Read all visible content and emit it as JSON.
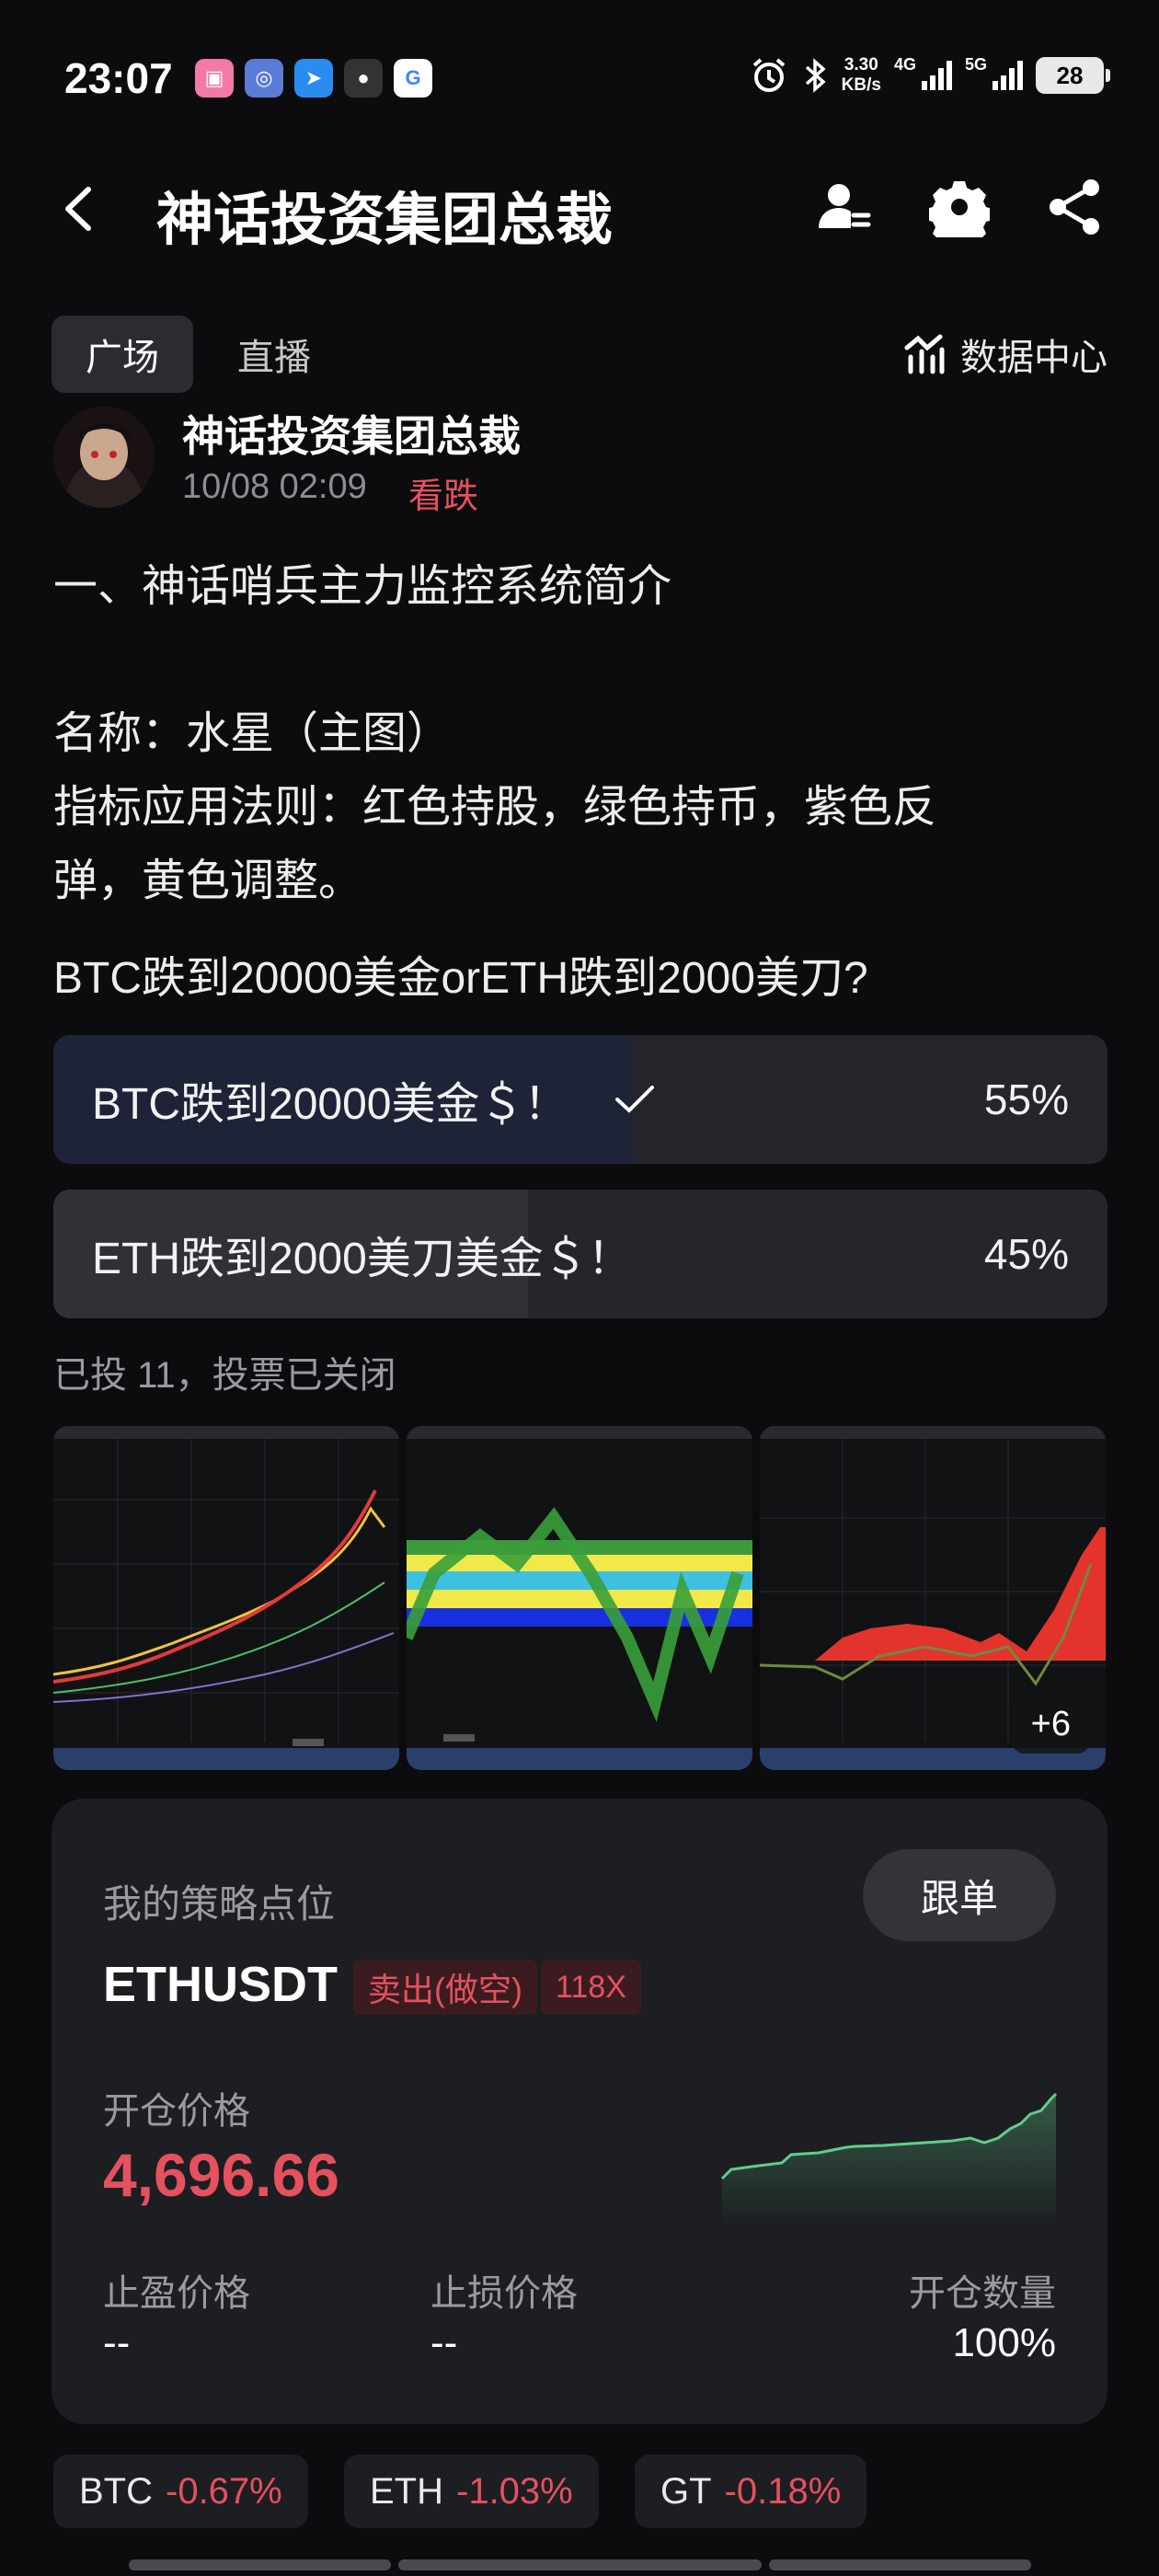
{
  "status_bar": {
    "time": "23:07",
    "net_speed_value": "3.30",
    "net_speed_unit": "KB/s",
    "net_4g": "4G",
    "net_5g": "5G",
    "battery": "28",
    "app_icons": [
      "bilibili-icon",
      "app-icon-2",
      "app-icon-3",
      "qq-icon",
      "google-icon"
    ]
  },
  "header": {
    "title": "神话投资集团总裁",
    "icons": [
      "back-icon",
      "follow-user-icon",
      "gear-icon",
      "share-icon"
    ]
  },
  "tabs": {
    "items": [
      "广场",
      "直播"
    ],
    "active": "广场",
    "data_center": "数据中心"
  },
  "post": {
    "author": "神话投资集团总裁",
    "time": "10/08 02:09",
    "sentiment": "看跌",
    "lines": [
      "一、神话哨兵主力监控系统简介",
      "名称：水星（主图）",
      "指标应用法则：红色持股，绿色持币，紫色反",
      "弹，黄色调整。"
    ]
  },
  "poll": {
    "question": "BTC跌到20000美金orETH跌到2000美刀?",
    "options": [
      {
        "label": "BTC跌到20000美金＄！",
        "percent": "55%",
        "fraction": 0.55,
        "selected": true
      },
      {
        "label": "ETH跌到2000美刀美金＄！",
        "percent": "45%",
        "fraction": 0.45,
        "selected": false
      }
    ],
    "meta": "已投 11，投票已关闭"
  },
  "images": {
    "more": "+6"
  },
  "strategy": {
    "title": "我的策略点位",
    "follow": "跟单",
    "symbol": "ETHUSDT",
    "side": "卖出(做空)",
    "leverage": "118X",
    "open_price_label": "开仓价格",
    "open_price": "4,696.66",
    "take_profit_label": "止盈价格",
    "take_profit": "--",
    "stop_loss_label": "止损价格",
    "stop_loss": "--",
    "size_label": "开仓数量",
    "size": "100%",
    "colors": {
      "up": "#5fcf8a",
      "down": "#e5515f"
    }
  },
  "tickers": [
    {
      "symbol": "BTC",
      "change": "-0.67%"
    },
    {
      "symbol": "ETH",
      "change": "-1.03%"
    },
    {
      "symbol": "GT",
      "change": "-0.18%"
    }
  ]
}
